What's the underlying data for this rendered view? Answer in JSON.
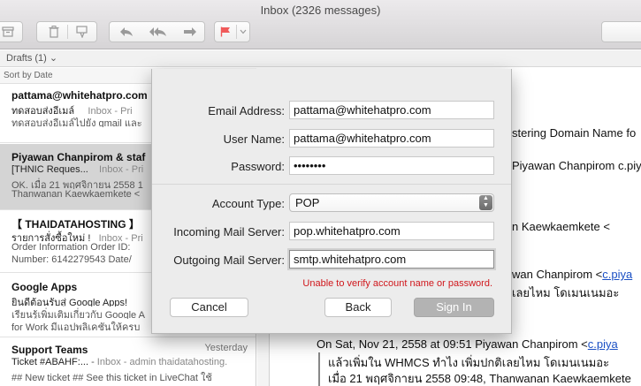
{
  "window": {
    "title": "Inbox (2326 messages)"
  },
  "toolbar": {
    "buttons": [
      {
        "icon": "archive-icon"
      },
      {
        "icon": "trash-icon"
      },
      {
        "icon": "junk-icon"
      },
      {
        "icon": "reply-icon"
      },
      {
        "icon": "reply-all-icon"
      },
      {
        "icon": "forward-icon"
      },
      {
        "icon": "flag-icon",
        "color": "#f05a5a"
      },
      {
        "icon": "chevron-down-icon"
      }
    ]
  },
  "favorites": {
    "drafts_label": "Drafts (1)"
  },
  "sort": {
    "label": "Sort by Date"
  },
  "messages": [
    {
      "sender": "pattama@whitehatpro.com",
      "subject": "ทดสอบส่งอีเมล์",
      "mailbox": "Inbox - Pri",
      "preview": "ทดสอบส่งอีเมล์ไปยัง gmail และ"
    },
    {
      "sender": "Piyawan Chanpirom & staf",
      "subject": "[THNIC Reques...",
      "mailbox": "Inbox - Pri",
      "preview": "OK. เมื่อ 21 พฤศจิกายน 2558 1",
      "preview2": "Thanwanan Kaewkaemkete <"
    },
    {
      "sender": "【 THAIDATAHOSTING 】",
      "subject": "รายการสั่งซื้อใหม่ !",
      "mailbox": "Inbox - Pri",
      "preview": "Order Information Order ID:",
      "preview2": "Number: 6142279543 Date/"
    },
    {
      "sender": "Google Apps",
      "subject": "ยินดีต้อนรับสู่ Google Apps!",
      "mailbox": "",
      "preview": "เรียนรู้เพิ่มเติมเกี่ยวกับ Google A",
      "preview2": "for Work มีแอปพลิเคชันให้ครบ"
    },
    {
      "sender": "Support Teams",
      "date": "Yesterday",
      "subject": "Ticket #ABAHF:...",
      "mailbox": "Inbox - admin thaidatahosting.",
      "preview": "## New ticket ## See this ticket in LiveChat ใช้"
    }
  ],
  "reader": {
    "lines": [
      "stering Domain Name fo",
      "Piyawan Chanpirom c.piya",
      "n Kaewkaemkete <",
      "wan Chanpirom <",
      "c.piya",
      "เลยไหม โดเมนเนมอะ",
      "On Sat, Nov 21, 2558 at 09:51 Piyawan Chanpirom <",
      "c.piya",
      "แล้วเพิ่มใน WHMCS ทำไง เพิ่มปกติเลยไหม โดเมนเนมอะ",
      "เมื่อ 21 พฤศจิกายน 2558 09:48, Thanwanan Kaewkaemkete"
    ]
  },
  "dialog": {
    "email": {
      "label": "Email Address:",
      "value": "pattama@whitehatpro.com"
    },
    "username": {
      "label": "User Name:",
      "value": "pattama@whitehatpro.com"
    },
    "password": {
      "label": "Password:",
      "value": "••••••••"
    },
    "account_type": {
      "label": "Account Type:",
      "value": "POP"
    },
    "incoming": {
      "label": "Incoming Mail Server:",
      "value": "pop.whitehatpro.com"
    },
    "outgoing": {
      "label": "Outgoing Mail Server:",
      "value": "smtp.whitehatpro.com"
    },
    "error": "Unable to verify account name or password.",
    "cancel": "Cancel",
    "back": "Back",
    "signin": "Sign In"
  },
  "colors": {
    "error": "#d0161b",
    "link": "#1a4fc4",
    "selection": "#d4d4d4"
  }
}
